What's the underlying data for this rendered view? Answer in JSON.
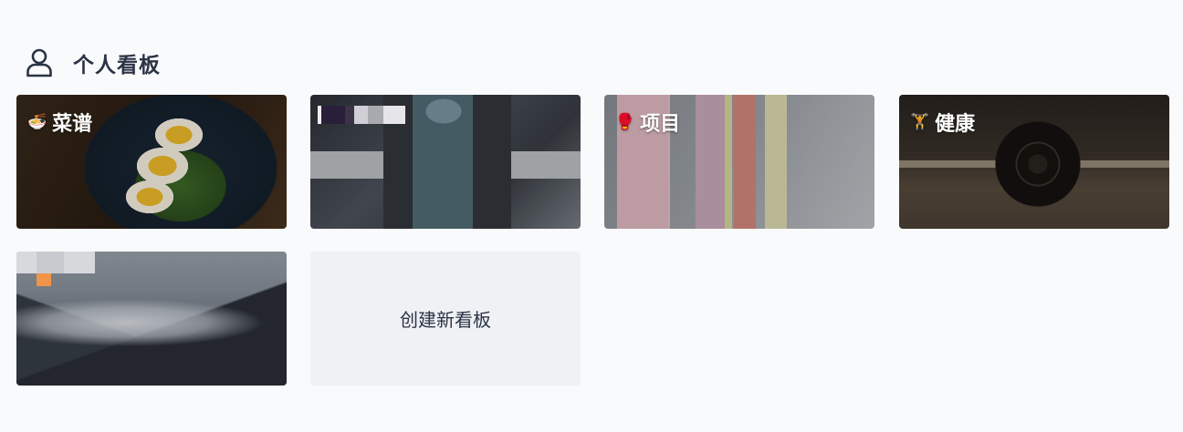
{
  "section": {
    "title": "个人看板",
    "icon": "person-icon"
  },
  "boards": [
    {
      "label": "菜谱",
      "emoji": "🍜"
    },
    {
      "label": ""
    },
    {
      "label": "项目",
      "emoji": "🥊"
    },
    {
      "label": "健康",
      "emoji": "🏋"
    },
    {
      "label": ""
    }
  ],
  "new_board_label": "创建新看板",
  "colors": {
    "background": "#f9fafc",
    "title_text": "#2b3445",
    "new_board_bg": "#f0f1f5"
  }
}
